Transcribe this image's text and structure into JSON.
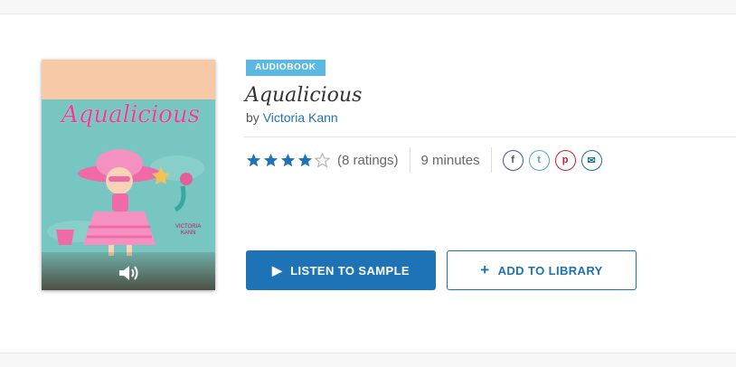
{
  "book": {
    "format_badge": "AUDIOBOOK",
    "title": "Aqualicious",
    "by_prefix": "by",
    "author": "Victoria Kann",
    "rating": 4,
    "rating_max": 5,
    "ratings_text": "(8 ratings)",
    "duration": "9 minutes"
  },
  "cover": {
    "title_art": "Aqualicious",
    "credit_line_1": "VICTORIA",
    "credit_line_2": "KANN",
    "speaker_icon": "speaker-icon"
  },
  "share": {
    "facebook": {
      "glyph": "f",
      "color": "#3b5998"
    },
    "twitter": {
      "glyph": "t",
      "color": "#4aa3df"
    },
    "pinterest": {
      "glyph": "p",
      "color": "#c8232c"
    },
    "email": {
      "glyph": "✉",
      "color": "#1b6f8a"
    }
  },
  "actions": {
    "listen_label": "LISTEN TO SAMPLE",
    "listen_icon": "play-icon",
    "add_label": "ADD TO LIBRARY",
    "add_icon": "plus-icon"
  },
  "colors": {
    "accent": "#1d73b6",
    "badge": "#5bb8e0",
    "star": "#1d73b6"
  }
}
